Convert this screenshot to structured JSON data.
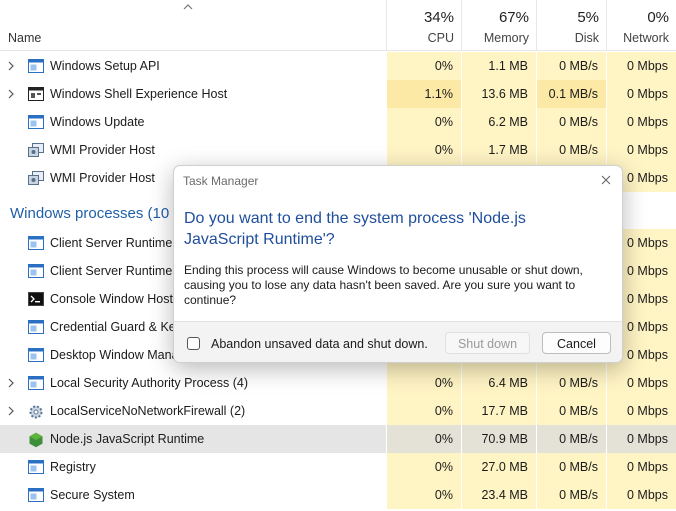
{
  "columns": {
    "name_label": "Name",
    "cpu": {
      "pct": "34%",
      "label": "CPU"
    },
    "memory": {
      "pct": "67%",
      "label": "Memory"
    },
    "disk": {
      "pct": "5%",
      "label": "Disk"
    },
    "network": {
      "pct": "0%",
      "label": "Network"
    }
  },
  "rows_top": [
    {
      "name": "Windows Setup API",
      "cpu": "0%",
      "mem": "1.1 MB",
      "disk": "0 MB/s",
      "net": "0 Mbps",
      "expand": true,
      "icon": "window-icon"
    },
    {
      "name": "Windows Shell Experience Host",
      "cpu": "1.1%",
      "mem": "13.6 MB",
      "disk": "0.1 MB/s",
      "net": "0 Mbps",
      "expand": true,
      "icon": "shell-host-icon"
    },
    {
      "name": "Windows Update",
      "cpu": "0%",
      "mem": "6.2 MB",
      "disk": "0 MB/s",
      "net": "0 Mbps",
      "expand": false,
      "icon": "window-icon"
    },
    {
      "name": "WMI Provider Host",
      "cpu": "0%",
      "mem": "1.7 MB",
      "disk": "0 MB/s",
      "net": "0 Mbps",
      "expand": false,
      "icon": "wmi-icon"
    },
    {
      "name": "WMI Provider Host",
      "cpu": "",
      "mem": "",
      "disk": "",
      "net": "0 Mbps",
      "expand": false,
      "icon": "wmi-icon"
    }
  ],
  "group_label": "Windows processes (10",
  "rows_bottom": [
    {
      "name": "Client Server Runtime P",
      "cpu": "",
      "mem": "",
      "disk": "",
      "net": "0 Mbps",
      "expand": false,
      "icon": "window-icon"
    },
    {
      "name": "Client Server Runtime P",
      "cpu": "",
      "mem": "",
      "disk": "",
      "net": "0 Mbps",
      "expand": false,
      "icon": "window-icon"
    },
    {
      "name": "Console Window Host",
      "cpu": "",
      "mem": "",
      "disk": "",
      "net": "0 Mbps",
      "expand": false,
      "icon": "console-icon"
    },
    {
      "name": "Credential Guard & Key",
      "cpu": "",
      "mem": "",
      "disk": "",
      "net": "0 Mbps",
      "expand": false,
      "icon": "window-icon"
    },
    {
      "name": "Desktop Window Manag",
      "cpu": "",
      "mem": "",
      "disk": "",
      "net": "0 Mbps",
      "expand": false,
      "icon": "window-icon"
    },
    {
      "name": "Local Security Authority Process (4)",
      "cpu": "0%",
      "mem": "6.4 MB",
      "disk": "0 MB/s",
      "net": "0 Mbps",
      "expand": true,
      "icon": "window-icon"
    },
    {
      "name": "LocalServiceNoNetworkFirewall (2)",
      "cpu": "0%",
      "mem": "17.7 MB",
      "disk": "0 MB/s",
      "net": "0 Mbps",
      "expand": true,
      "icon": "gear-icon"
    },
    {
      "name": "Node.js JavaScript Runtime",
      "cpu": "0%",
      "mem": "70.9 MB",
      "disk": "0 MB/s",
      "net": "0 Mbps",
      "expand": false,
      "icon": "nodejs-icon",
      "selected": true
    },
    {
      "name": "Registry",
      "cpu": "0%",
      "mem": "27.0 MB",
      "disk": "0 MB/s",
      "net": "0 Mbps",
      "expand": false,
      "icon": "window-icon"
    },
    {
      "name": "Secure System",
      "cpu": "0%",
      "mem": "23.4 MB",
      "disk": "0 MB/s",
      "net": "0 Mbps",
      "expand": false,
      "icon": "window-icon"
    }
  ],
  "dialog": {
    "title": "Task Manager",
    "heading": "Do you want to end the system process 'Node.js JavaScript Runtime'?",
    "body": "Ending this process will cause Windows to become unusable or shut down, causing you to lose any data hasn't been saved. Are you sure you want to continue?",
    "checkbox_label": "Abandon unsaved data and shut down.",
    "checkbox_checked": false,
    "shutdown_label": "Shut down",
    "cancel_label": "Cancel"
  },
  "colors": {
    "heat_light": "#fff4c4",
    "heat_medium": "#fce9a6",
    "accent": "#1f5fa8"
  }
}
